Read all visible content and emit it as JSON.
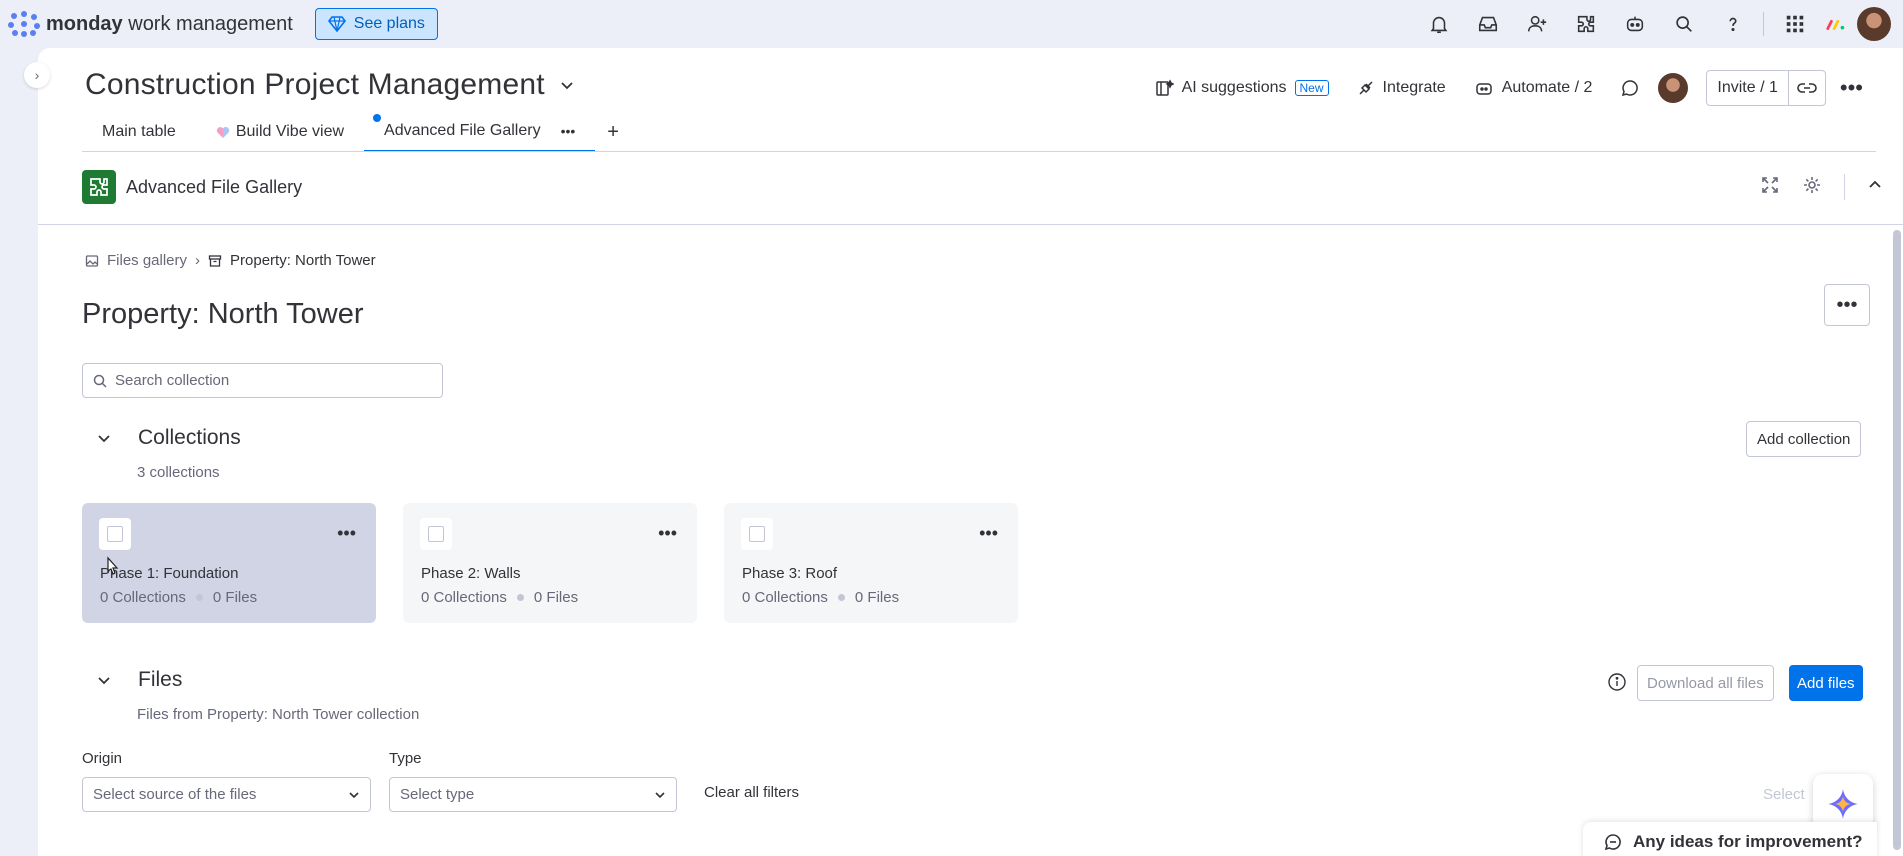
{
  "topbar": {
    "brand_bold": "monday",
    "brand_rest": " work management",
    "see_plans": "See plans",
    "icons": [
      "bell-icon",
      "inbox-icon",
      "invite-user-icon",
      "apps-icon",
      "ai-bot-icon",
      "search-icon",
      "help-icon",
      "grid-menu-icon"
    ]
  },
  "board": {
    "title": "Construction Project Management",
    "ai_suggestions": "AI suggestions",
    "new_badge": "New",
    "integrate": "Integrate",
    "automate": "Automate / 2",
    "invite": "Invite / 1"
  },
  "tabs": [
    {
      "label": "Main table"
    },
    {
      "label": "Build Vibe view"
    },
    {
      "label": "Advanced File Gallery"
    }
  ],
  "app": {
    "name": "Advanced File Gallery"
  },
  "breadcrumb": {
    "root": "Files gallery",
    "current": "Property: North Tower"
  },
  "page": {
    "title": "Property: North Tower",
    "search_placeholder": "Search collection"
  },
  "collections": {
    "heading": "Collections",
    "count": "3 collections",
    "add_button": "Add collection",
    "items": [
      {
        "name": "Phase 1: Foundation",
        "collections": "0 Collections",
        "files": "0 Files"
      },
      {
        "name": "Phase 2: Walls",
        "collections": "0 Collections",
        "files": "0 Files"
      },
      {
        "name": "Phase 3: Roof",
        "collections": "0 Collections",
        "files": "0 Files"
      }
    ]
  },
  "files": {
    "heading": "Files",
    "subtitle": "Files from Property: North Tower collection",
    "download_all": "Download all files",
    "add_files": "Add files",
    "origin_label": "Origin",
    "origin_placeholder": "Select source of the files",
    "type_label": "Type",
    "type_placeholder": "Select type",
    "clear_filters": "Clear all filters",
    "select_label": "Select"
  },
  "feedback": {
    "label": "Any ideas for improvement?"
  },
  "colors": {
    "accent": "#0073ea",
    "app_icon": "#1f7a33",
    "page_bg": "#eceff8"
  }
}
